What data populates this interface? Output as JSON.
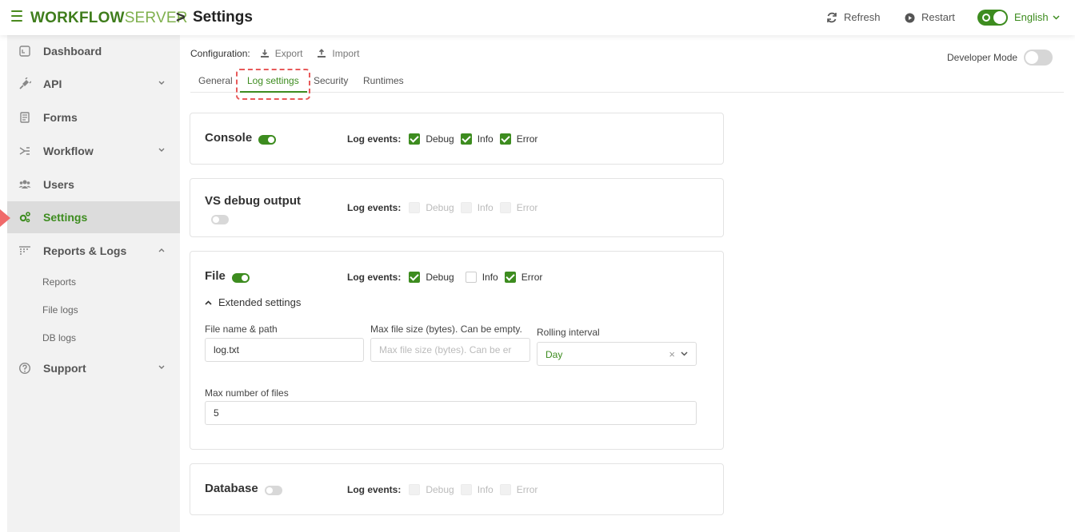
{
  "header": {
    "brand_bold": "WORKFLOW",
    "brand_light": "SERVER",
    "separator": ">",
    "page_title": "Settings",
    "refresh_label": "Refresh",
    "restart_label": "Restart",
    "language_label": "English"
  },
  "sidebar": {
    "items": [
      {
        "label": "Dashboard",
        "icon": "dashboard-icon"
      },
      {
        "label": "API",
        "icon": "plug-icon",
        "chevron": "down"
      },
      {
        "label": "Forms",
        "icon": "form-icon"
      },
      {
        "label": "Workflow",
        "icon": "workflow-icon",
        "chevron": "down"
      },
      {
        "label": "Users",
        "icon": "users-icon"
      },
      {
        "label": "Settings",
        "icon": "gears-icon",
        "active": true
      },
      {
        "label": "Reports & Logs",
        "icon": "reports-icon",
        "chevron": "up"
      },
      {
        "label": "Support",
        "icon": "help-icon",
        "chevron": "down"
      }
    ],
    "sub_items": [
      "Reports",
      "File logs",
      "DB logs"
    ]
  },
  "config": {
    "label": "Configuration:",
    "export_label": "Export",
    "import_label": "Import",
    "developer_mode_label": "Developer Mode",
    "developer_mode_on": false
  },
  "tabs": [
    {
      "label": "General"
    },
    {
      "label": "Log settings",
      "active": true
    },
    {
      "label": "Security"
    },
    {
      "label": "Runtimes"
    }
  ],
  "log_events_label": "Log events:",
  "sections": {
    "console": {
      "title": "Console",
      "enabled": true,
      "events": {
        "debug": "Debug",
        "info": "Info",
        "error": "Error"
      },
      "checked": {
        "debug": true,
        "info": true,
        "error": true
      }
    },
    "vs_debug": {
      "title": "VS debug output",
      "enabled": false,
      "events": {
        "debug": "Debug",
        "info": "Info",
        "error": "Error"
      }
    },
    "file": {
      "title": "File",
      "enabled": true,
      "events": {
        "debug": "Debug",
        "info": "Info",
        "error": "Error"
      },
      "checked": {
        "debug": true,
        "info": false,
        "error": true
      },
      "extended_label": "Extended settings",
      "file_name_label": "File name & path",
      "file_name_value": "log.txt",
      "max_size_label": "Max file size (bytes). Can be empty.",
      "max_size_placeholder": "Max file size (bytes). Can be er",
      "rolling_label": "Rolling interval",
      "rolling_value": "Day",
      "max_files_label": "Max number of files",
      "max_files_value": "5"
    },
    "database": {
      "title": "Database",
      "enabled": false,
      "events": {
        "debug": "Debug",
        "info": "Info",
        "error": "Error"
      }
    }
  },
  "colors": {
    "accent": "#3d8c1f",
    "highlight": "#e85a5a",
    "pointer": "#f06a6a"
  }
}
